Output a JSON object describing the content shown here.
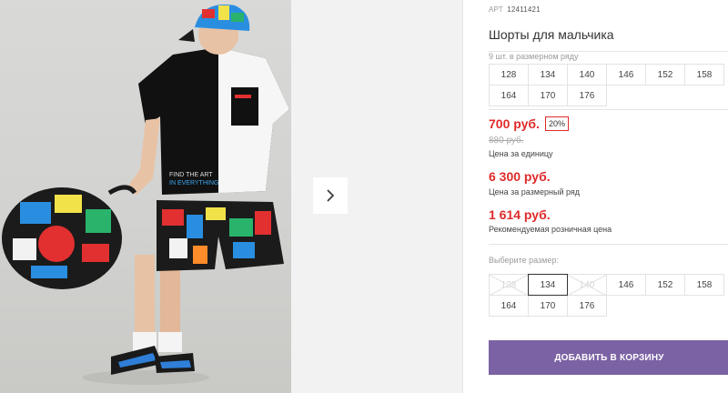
{
  "gallery": {
    "photo_alt": "Мальчик в шортах и футболке с рюкзаком",
    "next_icon": "chevron-right-icon"
  },
  "product": {
    "article_label": "АРТ",
    "article_value": "12411421",
    "title": "Шорты для мальчика",
    "size_range_note": "9 шт. в размерном ряду",
    "size_range": [
      "128",
      "134",
      "140",
      "146",
      "152",
      "158",
      "164",
      "170",
      "176"
    ],
    "price": "700 руб.",
    "discount": "20%",
    "old_price": "880 руб.",
    "price_unit_label": "Цена за единицу",
    "range_price": "6 300 руб.",
    "range_price_label": "Цена за размерный ряд",
    "retail_price": "1 614 руб.",
    "retail_price_label": "Рекомендуемая розничная цена",
    "choose_size_label": "Выберите размер:",
    "sizes": [
      {
        "label": "128",
        "state": "disabled"
      },
      {
        "label": "134",
        "state": "selected"
      },
      {
        "label": "140",
        "state": "disabled"
      },
      {
        "label": "146",
        "state": "available"
      },
      {
        "label": "152",
        "state": "available"
      },
      {
        "label": "158",
        "state": "available"
      },
      {
        "label": "164",
        "state": "available"
      },
      {
        "label": "170",
        "state": "available"
      },
      {
        "label": "176",
        "state": "available"
      }
    ],
    "add_to_cart": "ДОБАВИТЬ В КОРЗИНУ"
  },
  "colors": {
    "accent_button": "#7b62a4",
    "price_red": "#e02a2a"
  }
}
